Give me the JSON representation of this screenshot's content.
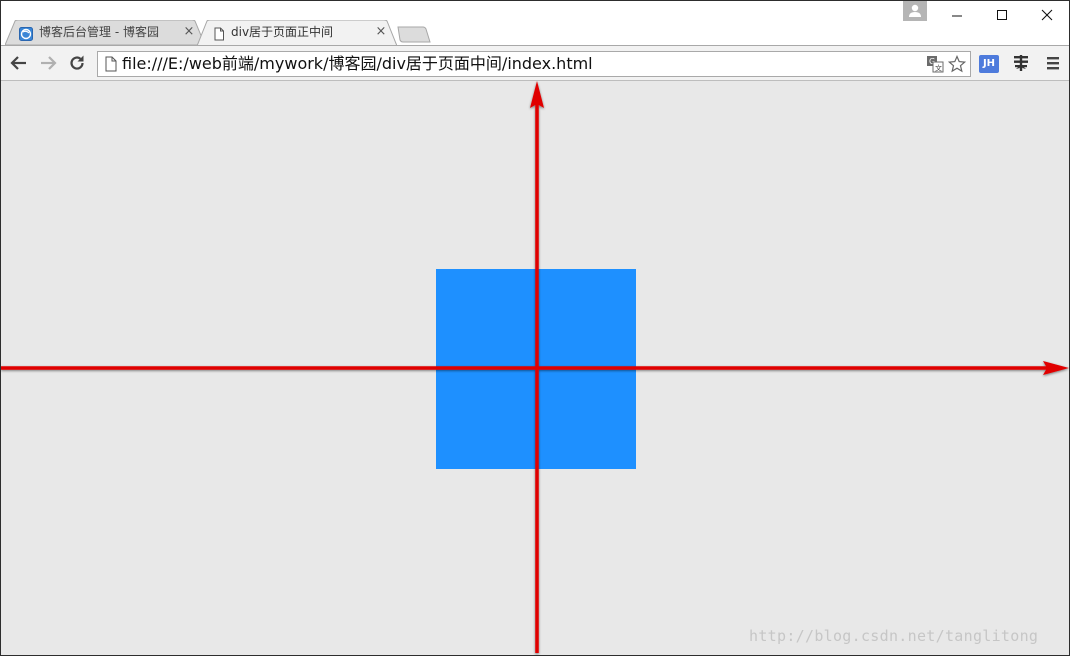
{
  "tabs": [
    {
      "title": "博客后台管理 - 博客园",
      "active": false
    },
    {
      "title": "div居于页面正中间",
      "active": true
    }
  ],
  "tab_close_glyph": "×",
  "new_tab_label": "",
  "window_controls": {
    "minimize": "minimize-icon",
    "maximize": "maximize-icon",
    "close": "close-icon"
  },
  "toolbar": {
    "back": "back-arrow-icon",
    "forward": "forward-arrow-icon",
    "reload": "reload-icon",
    "url": "file:///E:/web前端/mywork/博客园/div居于页面中间/index.html",
    "extension_jh_label": "JH"
  },
  "page": {
    "box_color": "#1e90ff",
    "arrow_color": "#e00000",
    "background": "#e8e8e8"
  },
  "watermark": "http://blog.csdn.net/tanglitong"
}
